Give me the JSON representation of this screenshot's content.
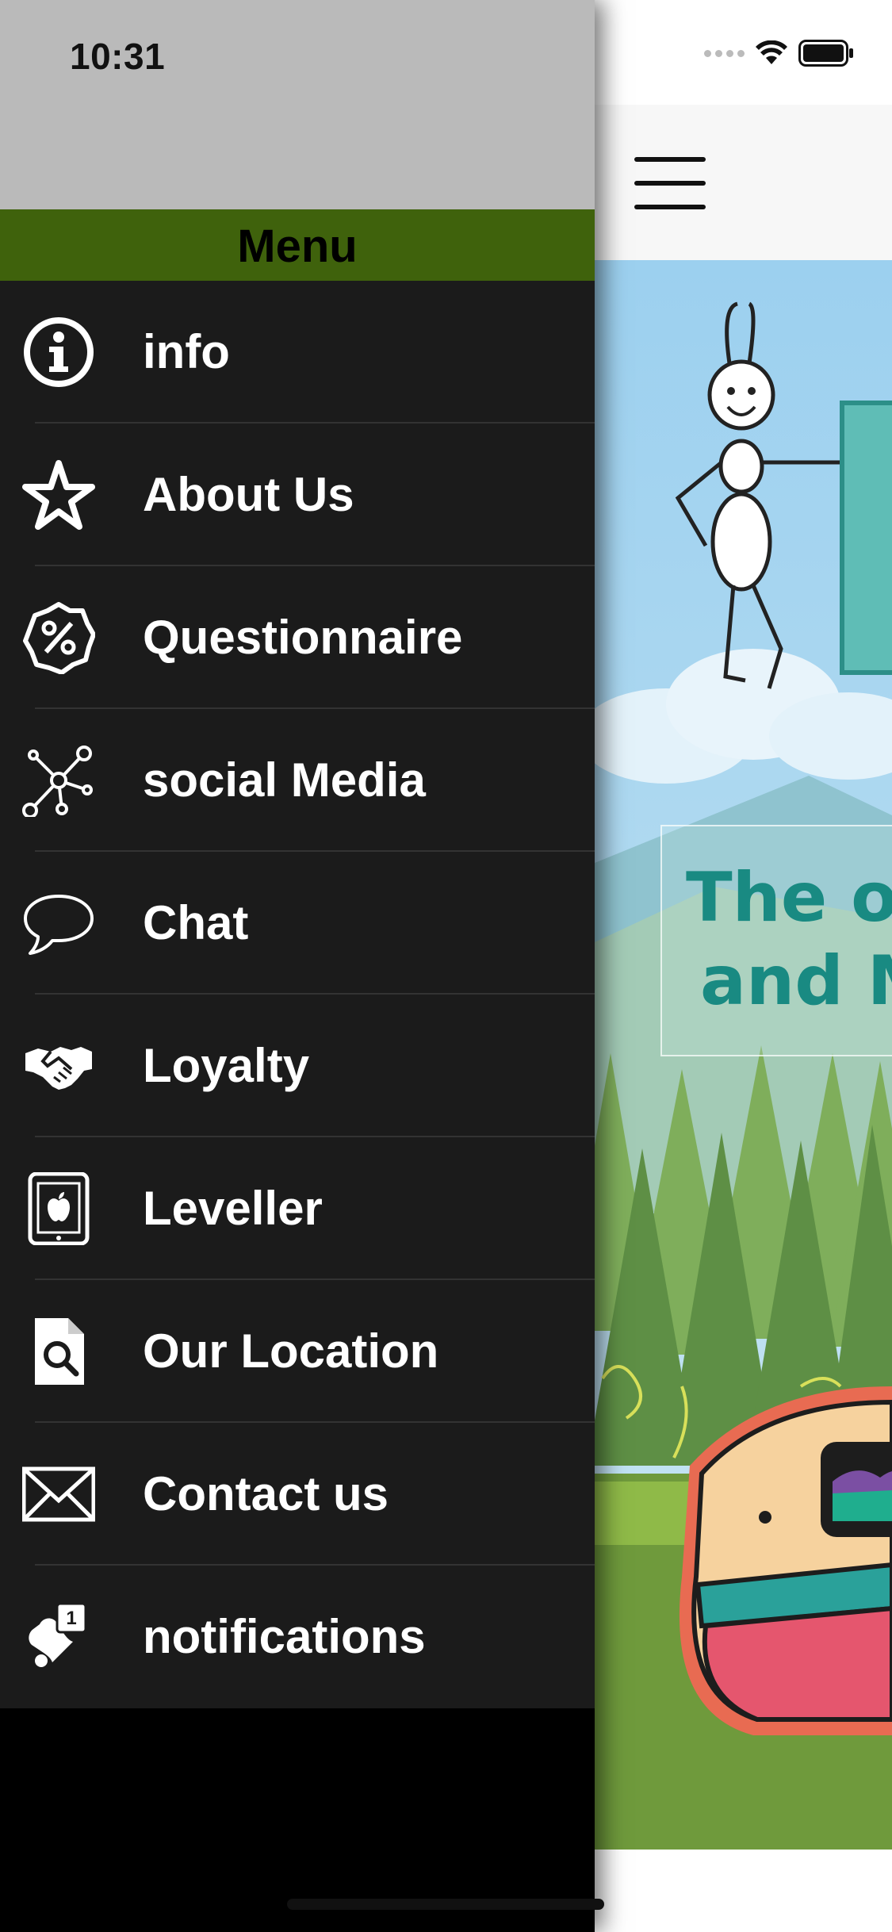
{
  "status_bar": {
    "time": "10:31",
    "icons": [
      "signal-dots-icon",
      "wifi-icon",
      "battery-icon"
    ]
  },
  "drawer": {
    "title": "Menu",
    "items": [
      {
        "label": "info",
        "icon": "info-icon"
      },
      {
        "label": "About Us",
        "icon": "star-icon"
      },
      {
        "label": "Questionnaire",
        "icon": "percent-badge-icon"
      },
      {
        "label": "social Media",
        "icon": "network-icon"
      },
      {
        "label": "Chat",
        "icon": "speech-bubble-icon"
      },
      {
        "label": "Loyalty",
        "icon": "handshake-icon"
      },
      {
        "label": "Leveller",
        "icon": "tablet-icon"
      },
      {
        "label": "Our Location",
        "icon": "document-search-icon"
      },
      {
        "label": "Contact us",
        "icon": "envelope-icon"
      },
      {
        "label": "notifications",
        "icon": "bell-badge-icon",
        "badge": "1"
      }
    ]
  },
  "content": {
    "menu_button": "hamburger-menu-icon",
    "banner_lines": [
      "The or",
      "and M"
    ]
  },
  "colors": {
    "drawer_background": "#1b1b1b",
    "menu_header": "#3f620c",
    "drawer_top": "#bababa",
    "banner_text": "#198a82"
  }
}
